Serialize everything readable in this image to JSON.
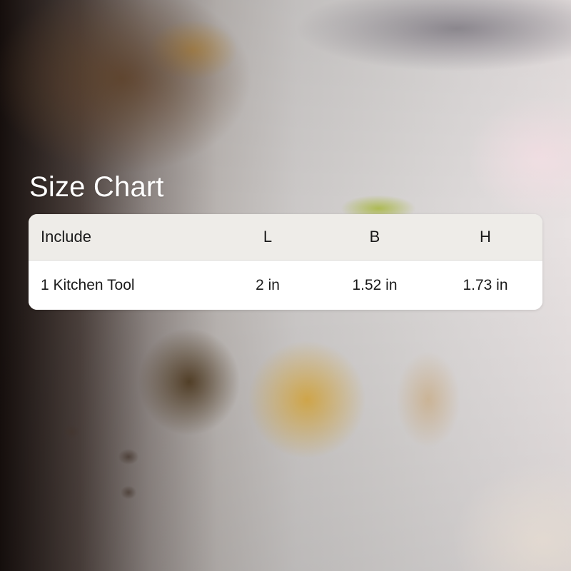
{
  "title": "Size Chart",
  "table": {
    "headers": [
      "Include",
      "L",
      "B",
      "H"
    ],
    "rows": [
      [
        "1 Kitchen Tool",
        "2 in",
        "1.52 in",
        "1.73 in"
      ]
    ]
  },
  "colors": {
    "title_text": "#ffffff",
    "header_bg": "#eeece8",
    "body_bg": "#ffffff",
    "cell_text": "#1a1a1a"
  }
}
